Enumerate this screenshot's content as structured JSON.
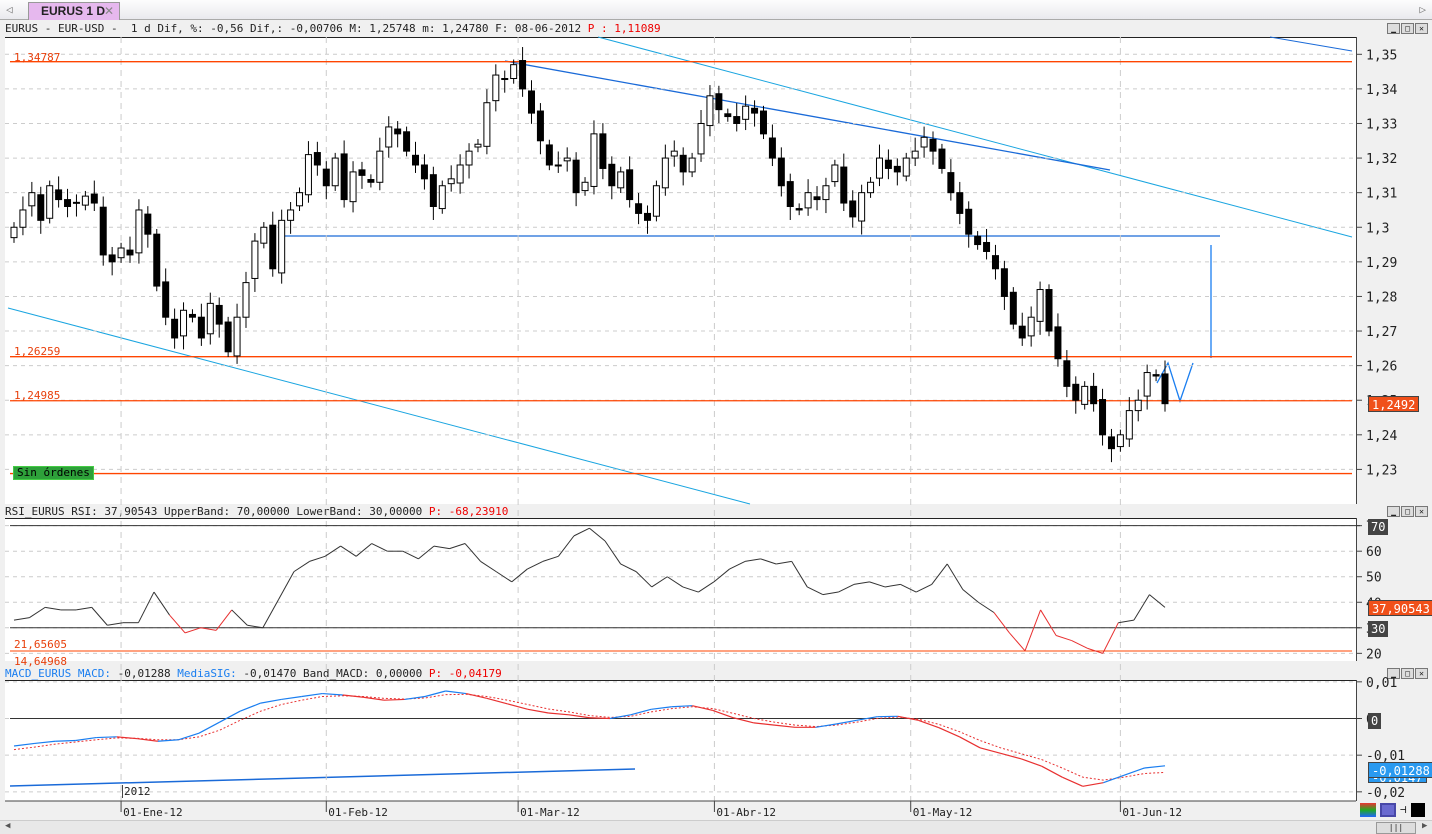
{
  "tab": {
    "title": "EURUS 1 D",
    "close": "✕"
  },
  "price_header": {
    "text": "EURUS - EUR-USD -  1 d Dif, %: -0,56 Dif,: -0,00706 M: 1,25748 m: 1,24780 F: 08-06-2012",
    "p": "P : 1,11089"
  },
  "rsi_header": {
    "text": "RSI_EURUS RSI: 37,90543 UpperBand: 70,00000 LowerBand: 30,00000",
    "p": "P: -68,23910"
  },
  "macd_header": {
    "macd_label": "MACD_EURUS MACD:",
    "macd_val": " -0,01288",
    "sig_label": " MediaSIG:",
    "sig_val": " -0,01470 Band_MACD: 0,00000",
    "p": " P: -0,04179"
  },
  "price_levels": [
    "1,34787",
    "1,26259",
    "1,24985"
  ],
  "rsi_levels": [
    "21,65605",
    "14,64968"
  ],
  "orders_badge": "Sin órdenes",
  "year_label": "2012",
  "current_price_tag": "1,2492",
  "rsi_tag": "37,90543",
  "rsi_band_tags": [
    "70",
    "30"
  ],
  "macd_zero_tag": "0",
  "macd_tag": "-0,01288",
  "macd_sig_tag": "-0,0147",
  "colors": {
    "level": "#ff4500",
    "trend_cyan": "#1aa5e0",
    "trend_blue": "#1a6ad8",
    "macd": "#1a7ef0",
    "signal": "#e83030"
  },
  "chart_data": [
    {
      "type": "candlestick",
      "title": "EURUS - EUR-USD 1 d",
      "ylim": [
        1.22,
        1.355
      ],
      "yticks": [
        1.35,
        1.34,
        1.33,
        1.32,
        1.31,
        1.3,
        1.29,
        1.28,
        1.27,
        1.26,
        1.25,
        1.24,
        1.23
      ],
      "ytick_labels": [
        "1,35",
        "1,34",
        "1,33",
        "1,32",
        "1,31",
        "1,3",
        "1,29",
        "1,28",
        "1,27",
        "1,26",
        "1,25",
        "1,24",
        "1,23"
      ],
      "levels": [
        1.34787,
        1.26259,
        1.24985,
        1.2288
      ],
      "closes": [
        1.3,
        1.305,
        1.31,
        1.302,
        1.312,
        1.308,
        1.306,
        1.307,
        1.309,
        1.307,
        1.292,
        1.29,
        1.294,
        1.292,
        1.305,
        1.298,
        1.283,
        1.274,
        1.268,
        1.276,
        1.274,
        1.268,
        1.278,
        1.272,
        1.264,
        1.274,
        1.284,
        1.296,
        1.3,
        1.288,
        1.302,
        1.305,
        1.31,
        1.321,
        1.318,
        1.312,
        1.32,
        1.308,
        1.316,
        1.315,
        1.313,
        1.322,
        1.329,
        1.327,
        1.322,
        1.318,
        1.314,
        1.306,
        1.312,
        1.314,
        1.318,
        1.322,
        1.324,
        1.336,
        1.344,
        1.343,
        1.347,
        1.34,
        1.333,
        1.325,
        1.318,
        1.318,
        1.32,
        1.31,
        1.313,
        1.327,
        1.317,
        1.312,
        1.316,
        1.308,
        1.304,
        1.302,
        1.312,
        1.32,
        1.322,
        1.316,
        1.32,
        1.33,
        1.338,
        1.334,
        1.332,
        1.33,
        1.335,
        1.333,
        1.327,
        1.32,
        1.312,
        1.306,
        1.305,
        1.31,
        1.308,
        1.312,
        1.318,
        1.307,
        1.303,
        1.31,
        1.313,
        1.32,
        1.317,
        1.316,
        1.32,
        1.322,
        1.326,
        1.322,
        1.317,
        1.31,
        1.304,
        1.298,
        1.295,
        1.293,
        1.288,
        1.28,
        1.272,
        1.268,
        1.274,
        1.282,
        1.27,
        1.262,
        1.254,
        1.25,
        1.254,
        1.249,
        1.24,
        1.236,
        1.24,
        1.247,
        1.25,
        1.258,
        1.257,
        1.249
      ],
      "date_labels": [
        {
          "label": "01-Ene-12",
          "bar": 12
        },
        {
          "label": "01-Feb-12",
          "bar": 35
        },
        {
          "label": "01-Mar-12",
          "bar": 56.5
        },
        {
          "label": "01-Abr-12",
          "bar": 78.5
        },
        {
          "label": "01-May-12",
          "bar": 100.5
        },
        {
          "label": "01-Jun-12",
          "bar": 124
        }
      ]
    },
    {
      "type": "line",
      "title": "RSI_EURUS",
      "ylim": [
        17,
        73
      ],
      "yticks": [
        70,
        60,
        50,
        40,
        30,
        20
      ],
      "ytick_labels": [
        "70",
        "60",
        "50",
        "40",
        "30",
        "20"
      ],
      "bands": [
        70,
        30
      ],
      "values": [
        33,
        34,
        38,
        37,
        37,
        38,
        31,
        32,
        32,
        44,
        35,
        28,
        30,
        29,
        37,
        31,
        30,
        41,
        52,
        56,
        58,
        62,
        58,
        63,
        60,
        60,
        57,
        62,
        61,
        63,
        56,
        52,
        48,
        53,
        56,
        58,
        66,
        69,
        64,
        55,
        52,
        46,
        50,
        46,
        44,
        48,
        53,
        56,
        57,
        55,
        56,
        46,
        43,
        44,
        47,
        48,
        46,
        47,
        44,
        47,
        55,
        45,
        40,
        36,
        28,
        21,
        37,
        27,
        25,
        22,
        20,
        32,
        33,
        43,
        38
      ]
    },
    {
      "type": "line",
      "title": "MACD_EURUS",
      "ylim": [
        -0.0225,
        0.0105
      ],
      "yticks": [
        0.01,
        0,
        -0.01,
        -0.02
      ],
      "ytick_labels": [
        "0,01",
        "0",
        "-0,01",
        "-0,02"
      ],
      "series": [
        {
          "name": "MACD",
          "values": [
            -0.0075,
            -0.0068,
            -0.0062,
            -0.006,
            -0.0052,
            -0.005,
            -0.0055,
            -0.0062,
            -0.0058,
            -0.004,
            -0.001,
            0.002,
            0.0042,
            0.0052,
            0.006,
            0.0068,
            0.0064,
            0.0058,
            0.005,
            0.0052,
            0.006,
            0.0075,
            0.0068,
            0.0055,
            0.004,
            0.0025,
            0.0015,
            0.001,
            0.0002,
            0.0,
            0.001,
            0.0025,
            0.0032,
            0.0035,
            0.0022,
            0.0002,
            -0.0012,
            -0.0018,
            -0.0024,
            -0.0024,
            -0.0015,
            -0.0005,
            0.0005,
            0.0006,
            -0.0005,
            -0.0025,
            -0.005,
            -0.008,
            -0.0095,
            -0.011,
            -0.013,
            -0.016,
            -0.0185,
            -0.0175,
            -0.0155,
            -0.0135,
            -0.0129
          ]
        },
        {
          "name": "MediaSIG",
          "values": [
            -0.0085,
            -0.0078,
            -0.007,
            -0.0064,
            -0.0058,
            -0.0053,
            -0.0054,
            -0.0058,
            -0.0058,
            -0.005,
            -0.0032,
            -0.0005,
            0.002,
            0.0038,
            0.005,
            0.006,
            0.0062,
            0.006,
            0.0055,
            0.0053,
            0.0056,
            0.0065,
            0.0066,
            0.006,
            0.005,
            0.0038,
            0.0026,
            0.0018,
            0.0008,
            0.0003,
            0.0006,
            0.0018,
            0.0027,
            0.0032,
            0.0027,
            0.0014,
            0.0,
            -0.001,
            -0.0018,
            -0.0022,
            -0.0018,
            -0.001,
            0.0,
            0.0004,
            -0.0002,
            -0.0016,
            -0.0036,
            -0.006,
            -0.008,
            -0.0096,
            -0.0112,
            -0.0135,
            -0.016,
            -0.0168,
            -0.016,
            -0.015,
            -0.0147
          ]
        }
      ]
    }
  ]
}
